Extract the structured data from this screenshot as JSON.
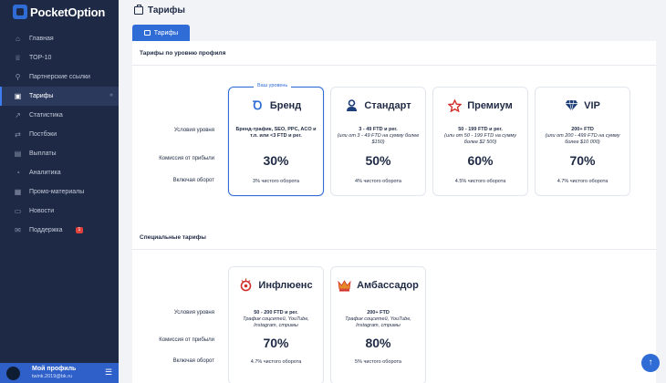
{
  "brand": {
    "name": "PocketOption"
  },
  "sidebar": {
    "items": [
      {
        "label": "Главная",
        "icon": "home-icon",
        "glyph": "⌂"
      },
      {
        "label": "TOP-10",
        "icon": "trophy-icon",
        "glyph": "♕"
      },
      {
        "label": "Партнерские ссылки",
        "icon": "link-icon",
        "glyph": "⚲"
      },
      {
        "label": "Тарифы",
        "icon": "briefcase-icon",
        "glyph": "▣",
        "active": true
      },
      {
        "label": "Статистика",
        "icon": "chart-icon",
        "glyph": "↗"
      },
      {
        "label": "Постбэки",
        "icon": "postback-icon",
        "glyph": "⇄"
      },
      {
        "label": "Выплаты",
        "icon": "wallet-icon",
        "glyph": "▤"
      },
      {
        "label": "Аналитика",
        "icon": "analytics-icon",
        "glyph": "◔"
      },
      {
        "label": "Промо-материалы",
        "icon": "image-icon",
        "glyph": "▦"
      },
      {
        "label": "Новости",
        "icon": "news-icon",
        "glyph": "▭"
      },
      {
        "label": "Поддержка",
        "icon": "support-icon",
        "glyph": "✉",
        "badge": "1"
      }
    ],
    "active_arrow": "«"
  },
  "profile": {
    "name": "Мой профиль",
    "email": "twink.2019@bk.ru",
    "menu_glyph": "☰"
  },
  "header": {
    "title": "Тарифы"
  },
  "tabs": [
    {
      "label": "Тарифы"
    }
  ],
  "labels": {
    "conditions": "Условия уровня",
    "commission": "Комиссия от прибыли",
    "turnover": "Включая оборот"
  },
  "profile_tariffs": {
    "heading": "Тарифы по уровню профиля",
    "current_tag": "Ваш уровень",
    "cards": [
      {
        "name": "Бренд",
        "icon": "brand-icon",
        "color": "#2f6cd6",
        "cond_bold": "Бренд-трафик, SEO, PPC, ACO и т.п. или <3 FTD и рег.",
        "cond_italic": "",
        "percent": "30%",
        "turnover": "3% чистого оборота",
        "current": true
      },
      {
        "name": "Стандарт",
        "icon": "user-icon",
        "color": "#1f3f7a",
        "cond_bold": "3 - 49 FTD и рег.",
        "cond_italic": "(или от 3 - 49 FTD на сумму более $150)",
        "percent": "50%",
        "turnover": "4% чистого оборота"
      },
      {
        "name": "Премиум",
        "icon": "star-icon",
        "color": "#d3312c",
        "cond_bold": "50 - 199 FTD и рег.",
        "cond_italic": "(или от 50 - 199 FTD на сумму более $2 500)",
        "percent": "60%",
        "turnover": "4.5% чистого оборота"
      },
      {
        "name": "VIP",
        "icon": "diamond-icon",
        "color": "#1f3f7a",
        "cond_bold": "200+ FTD",
        "cond_italic": "(или от 200 - 499 FTD на сумму более $10 000)",
        "percent": "70%",
        "turnover": "4.7% чистого оборота"
      }
    ]
  },
  "special_tariffs": {
    "heading": "Специальные тарифы",
    "cards": [
      {
        "name": "Инфлюенс",
        "icon": "influencer-icon",
        "color": "#d3312c",
        "cond_bold": "50 - 200 FTD и рег.",
        "cond_italic": "Трафик соцсетей, YouTube, Instagram, стримы",
        "percent": "70%",
        "turnover": "4.7% чистого оборота"
      },
      {
        "name": "Амбассадор",
        "icon": "crown-icon",
        "color": "#d3312c",
        "cond_bold": "200+ FTD",
        "cond_italic": "Трафик соцсетей, YouTube, Instagram, стримы",
        "percent": "80%",
        "turnover": "5% чистого оборота"
      }
    ]
  },
  "fab": {
    "glyph": "↑"
  }
}
